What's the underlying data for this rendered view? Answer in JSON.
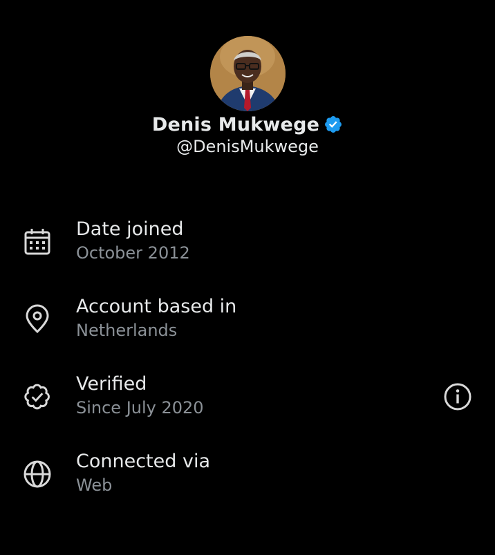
{
  "profile": {
    "display_name": "Denis Mukwege",
    "handle": "@DenisMukwege",
    "verified_badge_color": "#1d9bf0"
  },
  "about": {
    "items": [
      {
        "icon": "calendar-icon",
        "title": "Date joined",
        "value": "October 2012"
      },
      {
        "icon": "location-pin-icon",
        "title": "Account based in",
        "value": "Netherlands"
      },
      {
        "icon": "verified-check-icon",
        "title": "Verified",
        "value": "Since July 2020",
        "has_info": true
      },
      {
        "icon": "globe-icon",
        "title": "Connected via",
        "value": "Web"
      }
    ]
  },
  "colors": {
    "background": "#000000",
    "primary_text": "#e7e9ea",
    "secondary_text": "#8b9197",
    "icon": "#d9d9d9"
  }
}
